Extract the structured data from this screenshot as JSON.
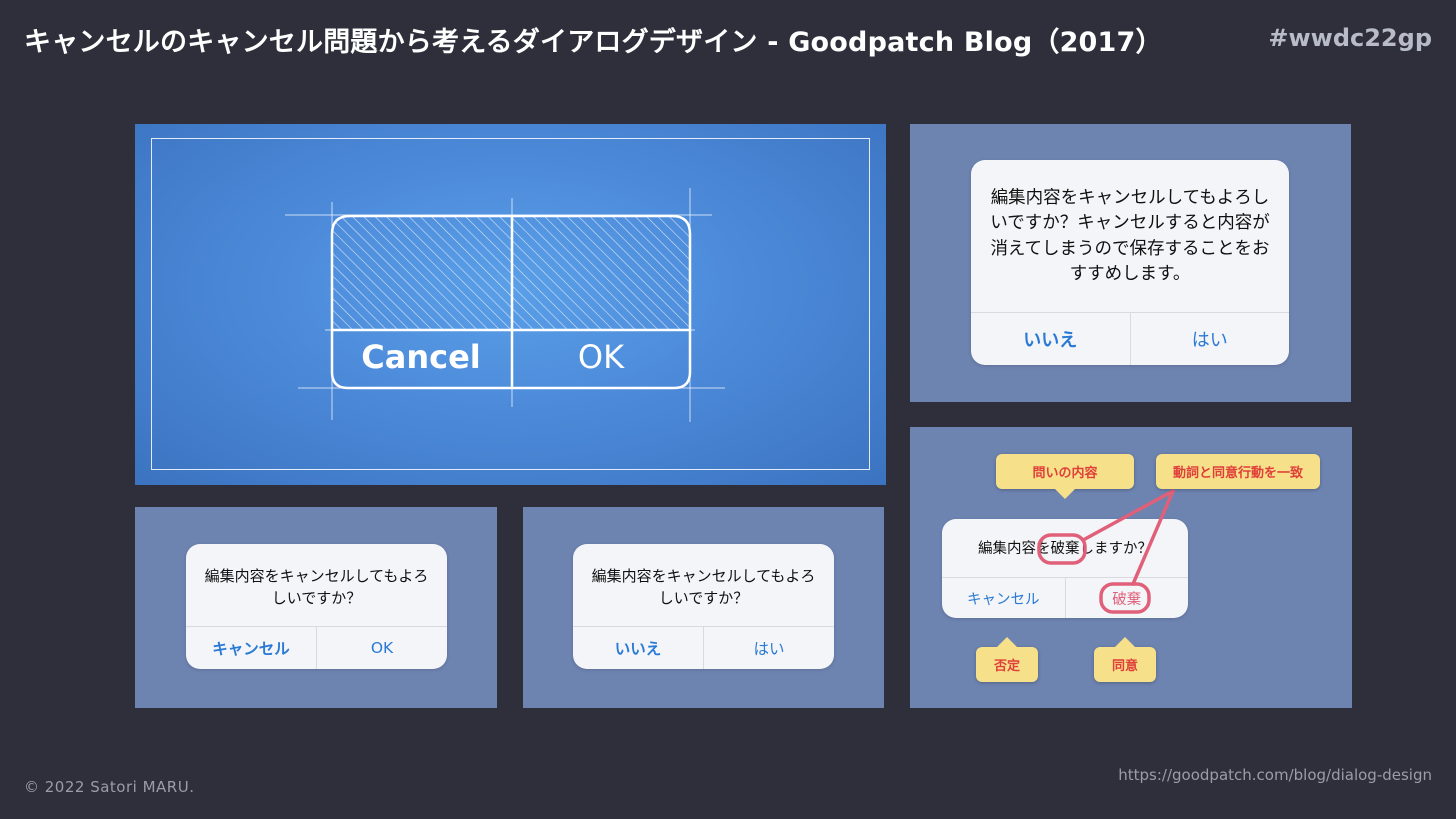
{
  "header": {
    "title": "キャンセルのキャンセル問題から考えるダイアログデザイン - Goodpatch Blog（2017）",
    "tag": "#wwdc22gp"
  },
  "footer": {
    "copyright": "© 2022 Satori MARU.",
    "url": "https://goodpatch.com/blog/dialog-design"
  },
  "blueprint": {
    "cancel_label": "Cancel",
    "ok_label": "OK"
  },
  "dialog_long": {
    "message": "編集内容をキャンセルしてもよろしいですか？キャンセルすると内容が消えてしまうので保存することをおすすめします。",
    "no_label": "いいえ",
    "yes_label": "はい"
  },
  "dialog_cancel_ok": {
    "message": "編集内容をキャンセルしてもよろしいですか？",
    "cancel_label": "キャンセル",
    "ok_label": "OK"
  },
  "dialog_no_yes": {
    "message": "編集内容をキャンセルしてもよろしいですか？",
    "no_label": "いいえ",
    "yes_label": "はい"
  },
  "dialog_discard": {
    "message_before": "編集内容を",
    "message_verb": "破棄",
    "message_after": "しますか？",
    "cancel_label": "キャンセル",
    "discard_label": "破棄"
  },
  "callouts": {
    "question_content": "問いの内容",
    "verb_match": "動詞と同意行動を一致",
    "negation": "否定",
    "agreement": "同意"
  },
  "colors": {
    "background": "#2e2f3a",
    "panel": "#6d83b0",
    "accent_blue": "#2a7ad5",
    "callout_yellow": "#f6e08a",
    "highlight_red": "#e0607a"
  }
}
